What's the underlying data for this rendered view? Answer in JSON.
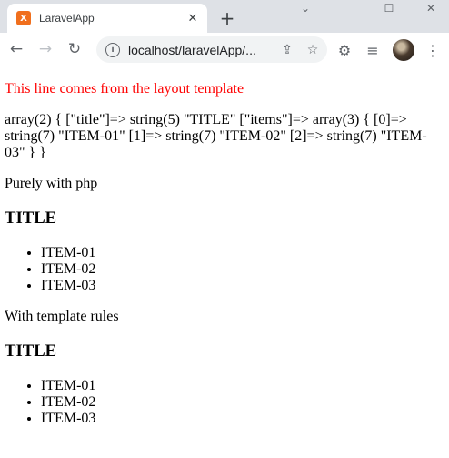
{
  "browser": {
    "tab_title": "LaravelApp",
    "favicon_letter": "X",
    "url": "localhost/laravelApp/...",
    "new_tab": "+",
    "close_tab": "✕"
  },
  "page": {
    "layout_line": "This line comes from the layout template",
    "dump": "array(2) { [\"title\"]=> string(5) \"TITLE\" [\"items\"]=> array(3) { [0]=> string(7) \"ITEM-01\" [1]=> string(7) \"ITEM-02\" [2]=> string(7) \"ITEM-03\" } }",
    "sections": [
      {
        "label": "Purely with php",
        "heading": "TITLE",
        "items": [
          "ITEM-01",
          "ITEM-02",
          "ITEM-03"
        ]
      },
      {
        "label": "With template rules",
        "heading": "TITLE",
        "items": [
          "ITEM-01",
          "ITEM-02",
          "ITEM-03"
        ]
      }
    ]
  },
  "colors": {
    "layout_line": "#ff0000",
    "favicon": "#f06f1d",
    "tabstrip": "#dee1e6"
  },
  "icons": [
    "favicon-icon",
    "close-icon",
    "plus-icon",
    "minimize-icon",
    "maximize-icon",
    "window-close-icon",
    "back-icon",
    "forward-icon",
    "reload-icon",
    "site-info-icon",
    "share-icon",
    "star-icon",
    "extensions-icon",
    "reading-list-icon",
    "avatar",
    "menu-icon"
  ]
}
